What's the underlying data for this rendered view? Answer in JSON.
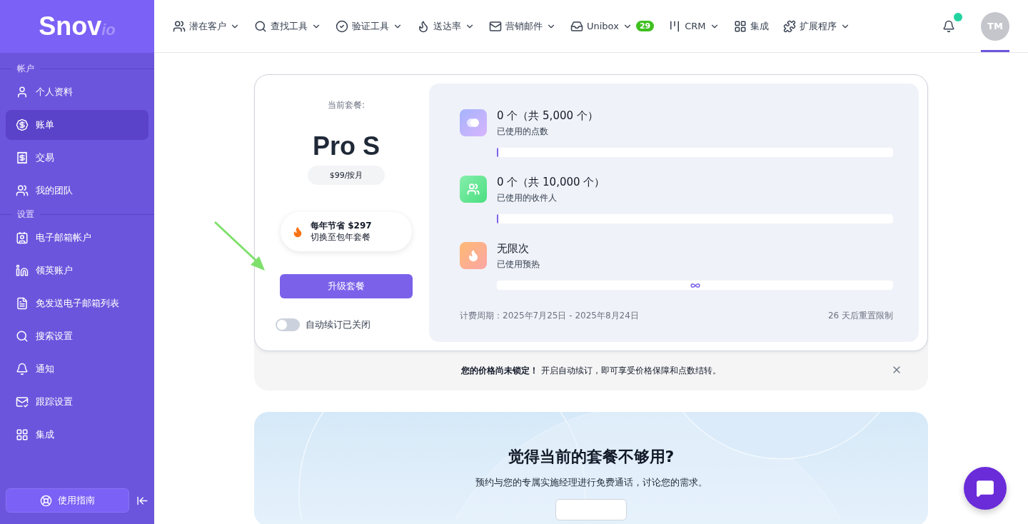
{
  "logo": {
    "text": "Snov",
    "suffix": "io"
  },
  "sidebar": {
    "sections": [
      {
        "title": "帐户",
        "items": [
          {
            "label": "个人资料",
            "selected": false
          },
          {
            "label": "账单",
            "selected": true
          },
          {
            "label": "交易",
            "selected": false
          },
          {
            "label": "我的团队",
            "selected": false
          }
        ]
      },
      {
        "title": "设置",
        "items": [
          {
            "label": "电子邮箱帐户",
            "selected": false
          },
          {
            "label": "领英账户",
            "selected": false
          },
          {
            "label": "免发送电子邮箱列表",
            "selected": false
          },
          {
            "label": "搜索设置",
            "selected": false
          },
          {
            "label": "通知",
            "selected": false
          },
          {
            "label": "跟踪设置",
            "selected": false
          },
          {
            "label": "集成",
            "selected": false
          }
        ]
      }
    ],
    "guide_button": "使用指南"
  },
  "topnav": {
    "items": [
      {
        "label": "潜在客户",
        "dropdown": true
      },
      {
        "label": "查找工具",
        "dropdown": true
      },
      {
        "label": "验证工具",
        "dropdown": true
      },
      {
        "label": "送达率",
        "dropdown": true
      },
      {
        "label": "营销邮件",
        "dropdown": true
      },
      {
        "label": "Unibox",
        "dropdown": true,
        "badge": "29"
      },
      {
        "label": "CRM",
        "dropdown": true
      },
      {
        "label": "集成",
        "dropdown": false
      },
      {
        "label": "扩展程序",
        "dropdown": true
      }
    ],
    "notifications": {
      "unread": true
    },
    "avatar": {
      "initials": "TM",
      "selected": true
    }
  },
  "plan": {
    "label": "当前套餐:",
    "name": "Pro S",
    "price": "$99/按月",
    "promo": {
      "title": "每年节省 $297",
      "subtitle": "切换至包年套餐"
    },
    "upgrade_button": "升级套餐",
    "auto_renew": {
      "label": "自动续订已关闭",
      "on": false
    }
  },
  "usage": [
    {
      "kind": "meter",
      "value": "0 个（共 5,000 个）",
      "label": "已使用的点数",
      "level": 0
    },
    {
      "kind": "meter",
      "value": "0 个（共 10,000 个）",
      "label": "已使用的收件人",
      "level": 0
    },
    {
      "kind": "unlimited",
      "value": "无限次",
      "label": "已使用预热"
    }
  ],
  "billing_period": "计费周期：2025年7月25日 - 2025年8月24日",
  "reset_note": "26 天后重置限制",
  "banner": {
    "text": "**您的价格尚未锁定！** 开启自动续订，即可享受价格保障和点数结转。"
  },
  "promo_card": {
    "title": "觉得当前的套餐不够用?",
    "subtitle": "预约与您的专属实施经理进行免费通话，讨论您的需求。"
  }
}
